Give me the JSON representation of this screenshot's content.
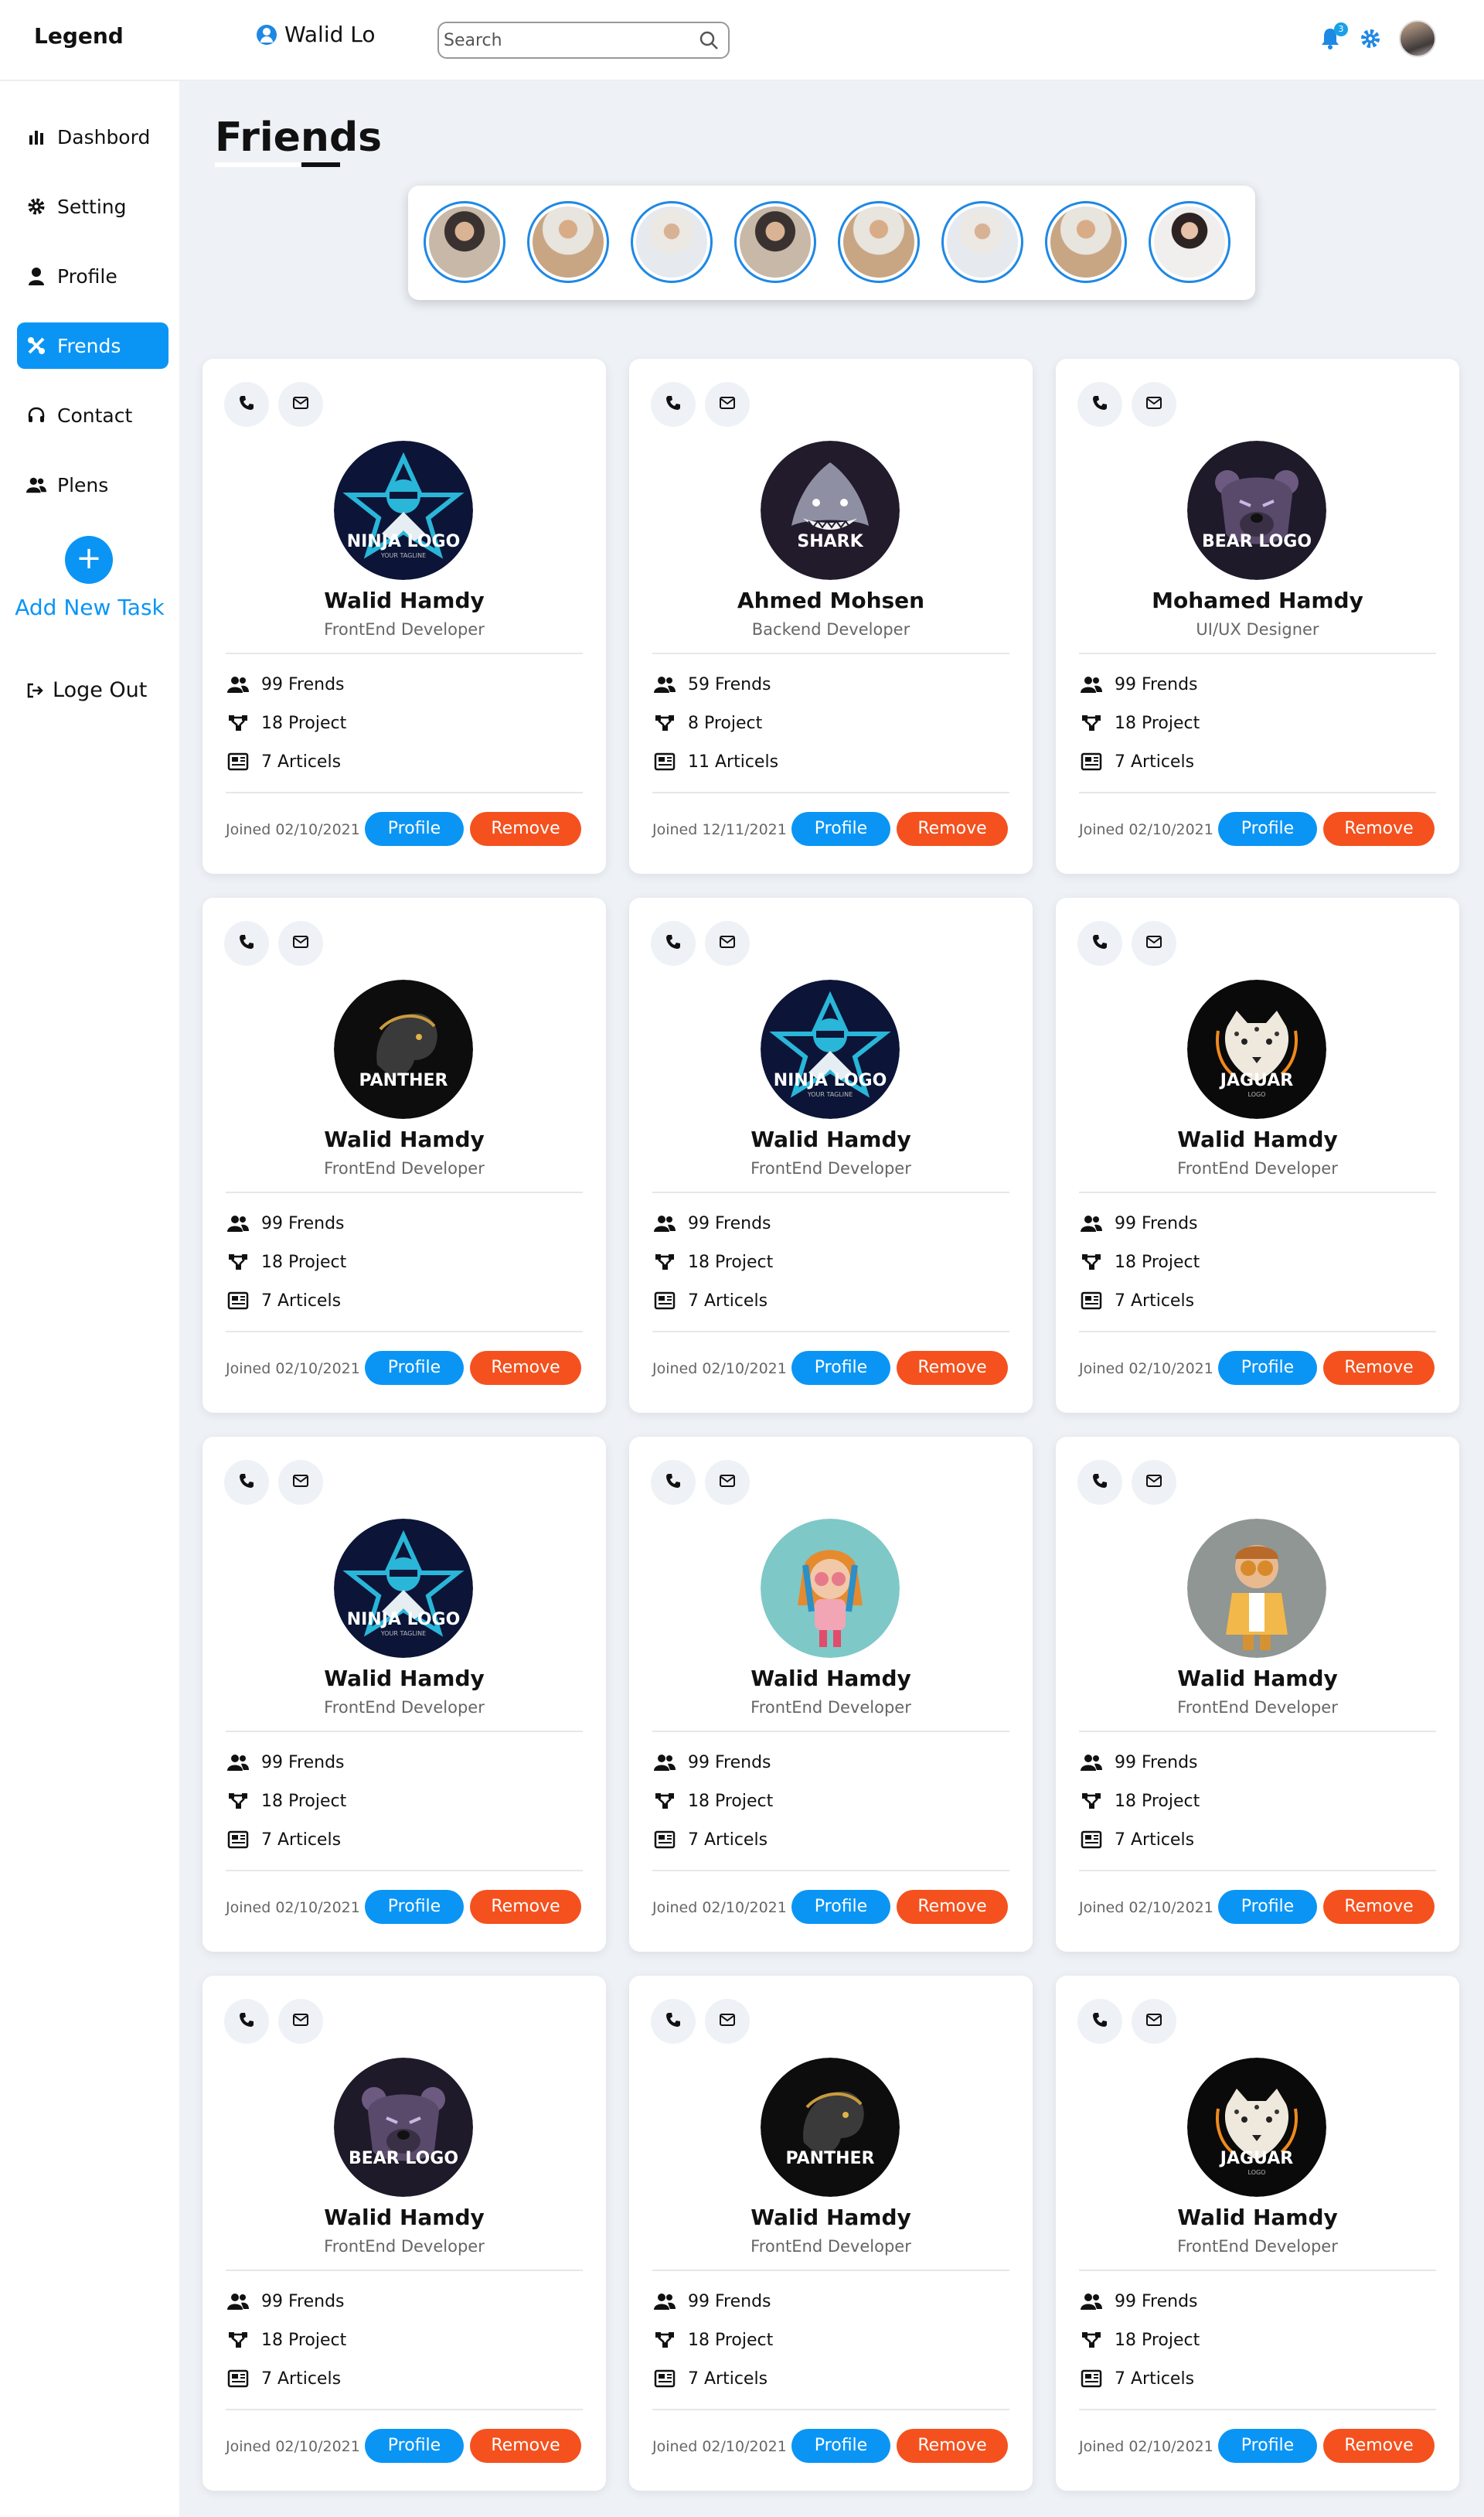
{
  "app": {
    "logo": "Legend",
    "username": "Walid Lo"
  },
  "search": {
    "placeholder": "Search"
  },
  "header": {
    "notification_count": "3"
  },
  "sidebar": {
    "items": [
      {
        "label": "Dashbord",
        "icon": "bar-chart-icon"
      },
      {
        "label": "Setting",
        "icon": "gear-icon"
      },
      {
        "label": "Profile",
        "icon": "user-icon"
      },
      {
        "label": "Frends",
        "icon": "tools-icon"
      },
      {
        "label": "Contact",
        "icon": "headphones-icon"
      },
      {
        "label": "Plens",
        "icon": "users-icon"
      }
    ],
    "active_index": 3,
    "add_task_label": "Add New Task",
    "add_task_symbol": "+",
    "logout_label": "Loge Out"
  },
  "page": {
    "title": "Friends"
  },
  "stories": [
    {
      "photo": "man-glasses-dark"
    },
    {
      "photo": "man-white-shirt"
    },
    {
      "photo": "man-sitting-light"
    },
    {
      "photo": "man-glasses-dark"
    },
    {
      "photo": "man-white-shirt"
    },
    {
      "photo": "man-sitting-light"
    },
    {
      "photo": "man-white-shirt"
    },
    {
      "photo": "woman-smiling"
    }
  ],
  "cards": [
    {
      "name": "Walid Hamdy",
      "role": "FrontEnd Developer",
      "friends": "99 Frends",
      "projects": "18 Project",
      "articles": "7 Articels",
      "joined": "Joined 02/10/2021",
      "logo_text": "NINJA LOGO",
      "logo_sub": "YOUR TAGLINE",
      "logo_kind": "ninja"
    },
    {
      "name": "Ahmed Mohsen",
      "role": "Backend Developer",
      "friends": "59 Frends",
      "projects": "8 Project",
      "articles": "11 Articels",
      "joined": "Joined 12/11/2021",
      "logo_text": "SHARK",
      "logo_sub": "",
      "logo_kind": "shark"
    },
    {
      "name": "Mohamed Hamdy",
      "role": "UI/UX Designer",
      "friends": "99 Frends",
      "projects": "18 Project",
      "articles": "7 Articels",
      "joined": "Joined 02/10/2021",
      "logo_text": "BEAR LOGO",
      "logo_sub": "",
      "logo_kind": "bear"
    },
    {
      "name": "Walid Hamdy",
      "role": "FrontEnd Developer",
      "friends": "99 Frends",
      "projects": "18 Project",
      "articles": "7 Articels",
      "joined": "Joined 02/10/2021",
      "logo_text": "PANTHER",
      "logo_sub": "",
      "logo_kind": "panther"
    },
    {
      "name": "Walid Hamdy",
      "role": "FrontEnd Developer",
      "friends": "99 Frends",
      "projects": "18 Project",
      "articles": "7 Articels",
      "joined": "Joined 02/10/2021",
      "logo_text": "NINJA LOGO",
      "logo_sub": "YOUR TAGLINE",
      "logo_kind": "ninja"
    },
    {
      "name": "Walid Hamdy",
      "role": "FrontEnd Developer",
      "friends": "99 Frends",
      "projects": "18 Project",
      "articles": "7 Articels",
      "joined": "Joined 02/10/2021",
      "logo_text": "JAGUAR",
      "logo_sub": "LOGO",
      "logo_kind": "jaguar"
    },
    {
      "name": "Walid Hamdy",
      "role": "FrontEnd Developer",
      "friends": "99 Frends",
      "projects": "18 Project",
      "articles": "7 Articels",
      "joined": "Joined 02/10/2021",
      "logo_text": "NINJA LOGO",
      "logo_sub": "YOUR TAGLINE",
      "logo_kind": "ninja"
    },
    {
      "name": "Walid Hamdy",
      "role": "FrontEnd Developer",
      "friends": "99 Frends",
      "projects": "18 Project",
      "articles": "7 Articels",
      "joined": "Joined 02/10/2021",
      "logo_text": "",
      "logo_sub": "",
      "logo_kind": "girl3d"
    },
    {
      "name": "Walid Hamdy",
      "role": "FrontEnd Developer",
      "friends": "99 Frends",
      "projects": "18 Project",
      "articles": "7 Articels",
      "joined": "Joined 02/10/2021",
      "logo_text": "",
      "logo_sub": "",
      "logo_kind": "boy3d"
    },
    {
      "name": "Walid Hamdy",
      "role": "FrontEnd Developer",
      "friends": "99 Frends",
      "projects": "18 Project",
      "articles": "7 Articels",
      "joined": "Joined 02/10/2021",
      "logo_text": "BEAR LOGO",
      "logo_sub": "",
      "logo_kind": "bear"
    },
    {
      "name": "Walid Hamdy",
      "role": "FrontEnd Developer",
      "friends": "99 Frends",
      "projects": "18 Project",
      "articles": "7 Articels",
      "joined": "Joined 02/10/2021",
      "logo_text": "PANTHER",
      "logo_sub": "",
      "logo_kind": "panther"
    },
    {
      "name": "Walid Hamdy",
      "role": "FrontEnd Developer",
      "friends": "99 Frends",
      "projects": "18 Project",
      "articles": "7 Articels",
      "joined": "Joined 02/10/2021",
      "logo_text": "JAGUAR",
      "logo_sub": "LOGO",
      "logo_kind": "jaguar"
    }
  ],
  "card_labels": {
    "profile_button": "Profile",
    "remove_button": "Remove"
  },
  "colors": {
    "accent": "#0a95f5",
    "danger": "#f4511e",
    "background": "#eef1f6"
  }
}
